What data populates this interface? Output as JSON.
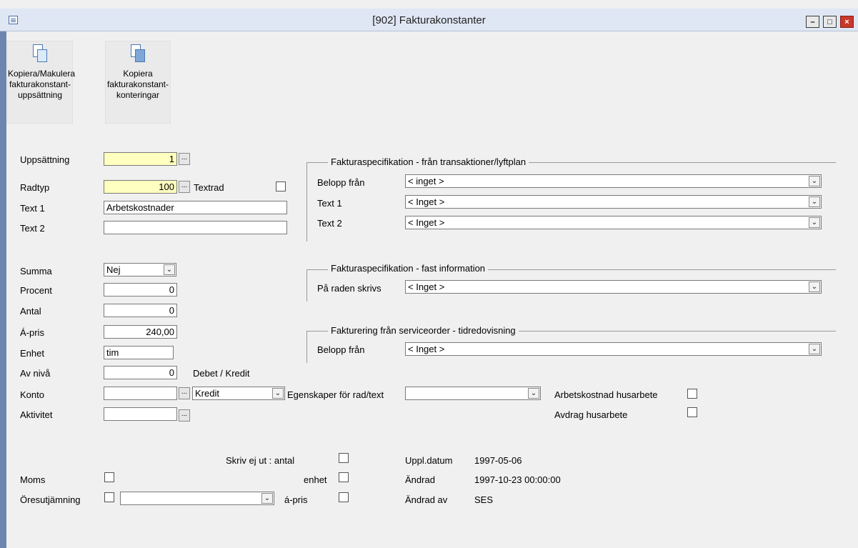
{
  "window": {
    "title": "[902]  Fakturakonstanter",
    "minimize": "–",
    "maximize": "□",
    "close": "×"
  },
  "toolbar": {
    "copy_cancel": [
      "Kopiera/Makulera",
      "fakturakonstant-",
      "uppsättning"
    ],
    "copy_accounts": [
      "Kopiera",
      "fakturakonstant-",
      "konteringar"
    ]
  },
  "form": {
    "uppsattning": {
      "label": "Uppsättning",
      "value": "1"
    },
    "radtyp": {
      "label": "Radtyp",
      "value": "100"
    },
    "textrad": {
      "label": "Textrad"
    },
    "text1": {
      "label": "Text 1",
      "value": "Arbetskostnader"
    },
    "text2": {
      "label": "Text 2",
      "value": ""
    },
    "summa": {
      "label": "Summa",
      "value": "Nej"
    },
    "procent": {
      "label": "Procent",
      "value": "0"
    },
    "antal": {
      "label": "Antal",
      "value": "0"
    },
    "apris": {
      "label": "Á-pris",
      "value": "240,00"
    },
    "enhet": {
      "label": "Enhet",
      "value": "tim"
    },
    "avniva": {
      "label": "Av nivå",
      "value": "0"
    },
    "debet_kredit_label": "Debet / Kredit",
    "konto": {
      "label": "Konto",
      "value": "",
      "debet_kredit": "Kredit"
    },
    "egenskaper": {
      "label": "Egenskaper för rad/text",
      "value": ""
    },
    "aktivitet": {
      "label": "Aktivitet",
      "value": ""
    },
    "arbetskostnad_husarbete": "Arbetskostnad husarbete",
    "avdrag_husarbete": "Avdrag husarbete"
  },
  "groups": {
    "transaktioner": {
      "title": "Fakturaspecifikation - från transaktioner/lyftplan",
      "rows": [
        {
          "label": "Belopp från",
          "value": "< inget >"
        },
        {
          "label": "Text 1",
          "value": "< Inget >"
        },
        {
          "label": "Text 2",
          "value": "< Inget >"
        }
      ]
    },
    "fast": {
      "title": "Fakturaspecifikation - fast information",
      "rows": [
        {
          "label": "På raden skrivs",
          "value": "< Inget >"
        }
      ]
    },
    "service": {
      "title": "Fakturering från serviceorder - tidredovisning",
      "rows": [
        {
          "label": "Belopp från",
          "value": "< Inget >"
        }
      ]
    }
  },
  "bottom": {
    "skriv_ej_ut": "Skriv ej ut : antal",
    "enhet": "enhet",
    "apris": "á-pris",
    "moms": "Moms",
    "oresutjamning": "Öresutjämning",
    "oresutjamning_value": "",
    "uppl_datum_label": "Uppl.datum",
    "uppl_datum": "1997-05-06",
    "andrad_label": "Ändrad",
    "andrad": "1997-10-23 00:00:00",
    "andrad_av_label": "Ändrad av",
    "andrad_av": "SES"
  },
  "icons": {
    "arrow": "⌄",
    "ellipsis": "..."
  }
}
